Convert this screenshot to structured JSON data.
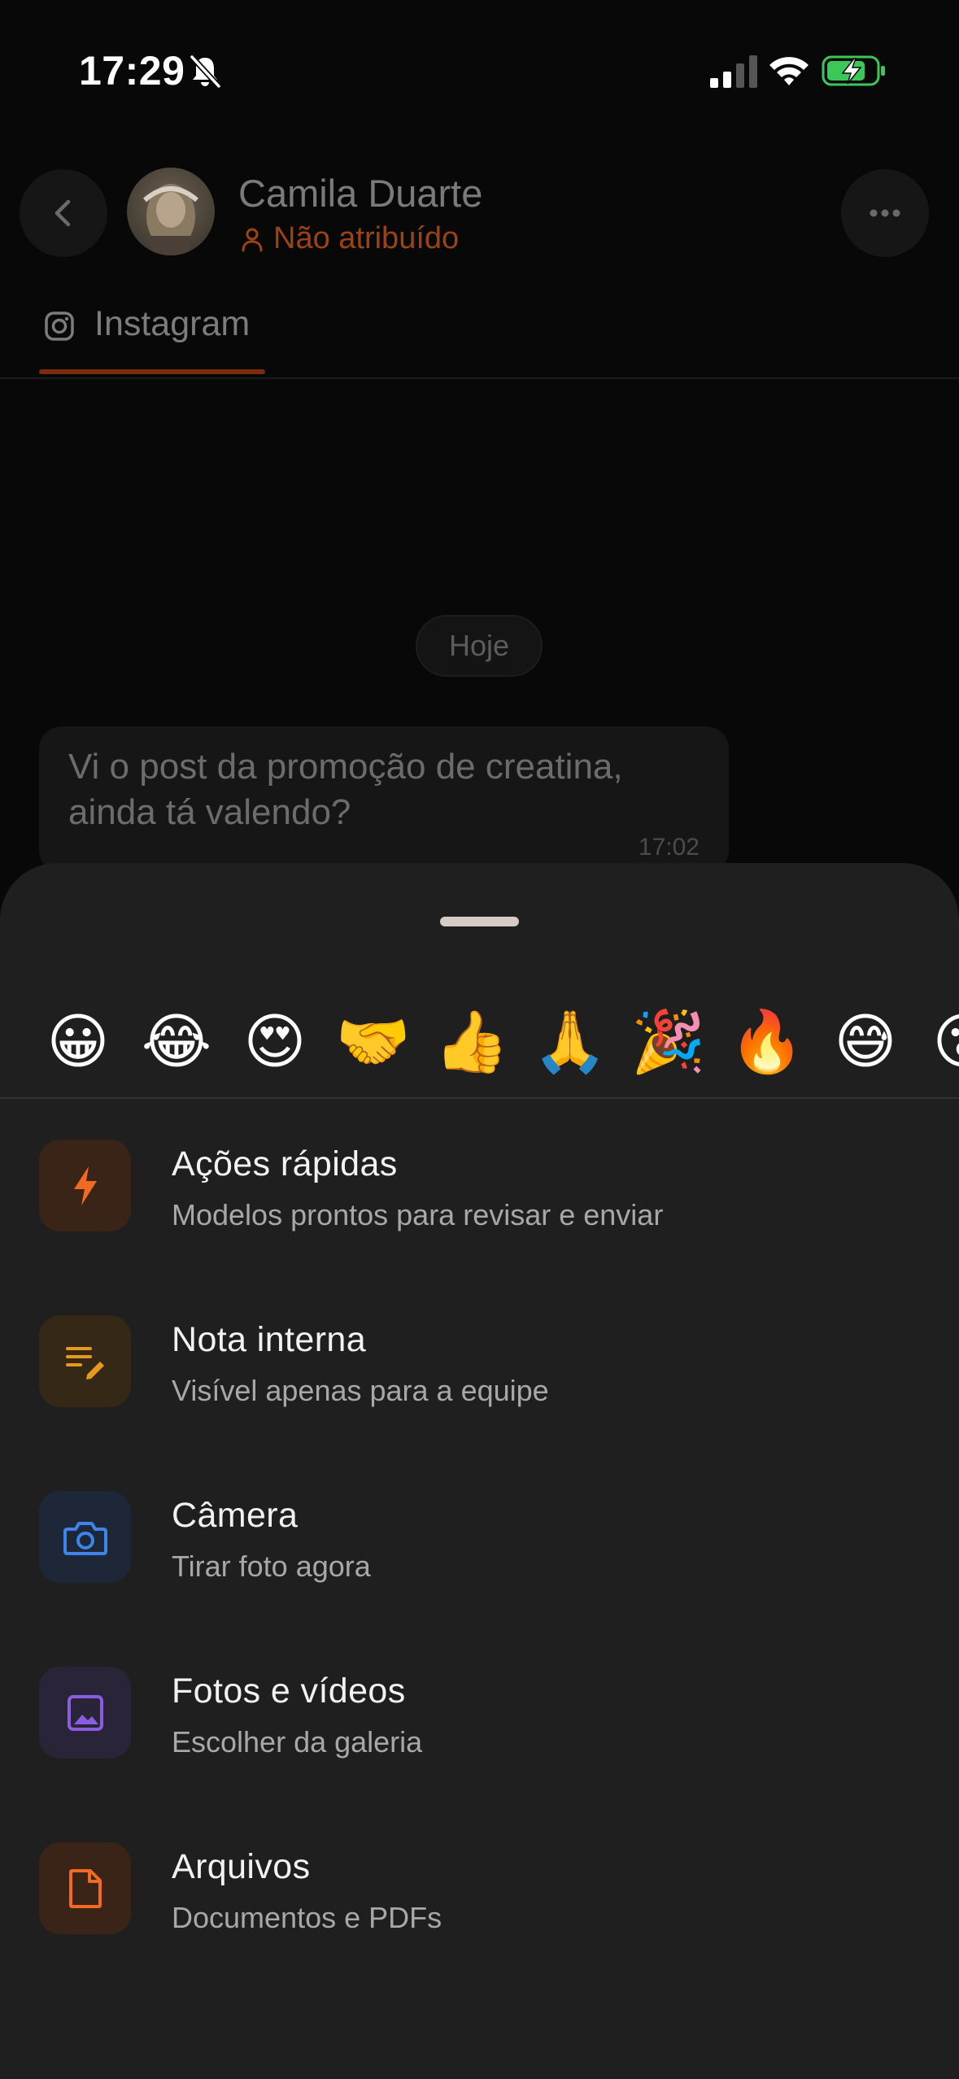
{
  "status_bar": {
    "time": "17:29"
  },
  "header": {
    "contact_name": "Camila Duarte",
    "assignment": "Não atribuído",
    "assignment_color": "#9a4414"
  },
  "tab": {
    "label": "Instagram",
    "accent": "#7a2c0c"
  },
  "chat": {
    "date_chip": "Hoje",
    "message": {
      "text": "Vi o post da promoção de creatina, ainda tá valendo?",
      "time": "17:02"
    }
  },
  "sheet": {
    "emojis": [
      "😀",
      "😂",
      "😍",
      "🤝",
      "👍",
      "🙏",
      "🎉",
      "🔥",
      "😅",
      "😮"
    ],
    "actions": [
      {
        "title": "Ações rápidas",
        "subtitle": "Modelos prontos para revisar e enviar",
        "icon": "bolt-icon",
        "color": "#f26a21",
        "bg": "#3a2417"
      },
      {
        "title": "Nota interna",
        "subtitle": "Visível apenas para a equipe",
        "icon": "note-edit-icon",
        "color": "#e59a1d",
        "bg": "#352816"
      },
      {
        "title": "Câmera",
        "subtitle": "Tirar foto agora",
        "icon": "camera-icon",
        "color": "#3f84e8",
        "bg": "#1d2738"
      },
      {
        "title": "Fotos e vídeos",
        "subtitle": "Escolher da galeria",
        "icon": "image-icon",
        "color": "#8a5ce0",
        "bg": "#2a2438"
      },
      {
        "title": "Arquivos",
        "subtitle": "Documentos e PDFs",
        "icon": "file-icon",
        "color": "#f26a21",
        "bg": "#3a2417"
      }
    ]
  }
}
